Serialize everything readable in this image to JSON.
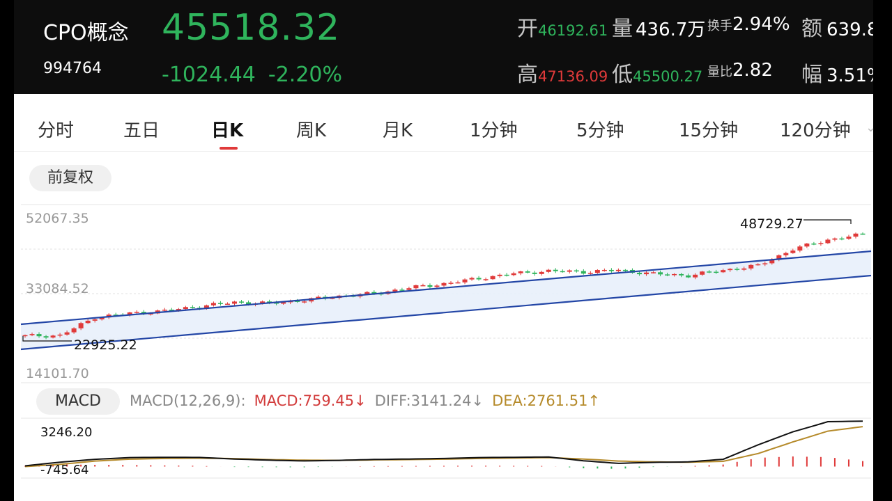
{
  "header": {
    "name": "CPO概念",
    "code": "994764",
    "price": "45518.32",
    "change": "-1024.44",
    "change_pct": "-2.20%",
    "open_label": "开",
    "open": "46192.61",
    "volume_label": "量",
    "volume": "436.7万",
    "turnover_label": "换手",
    "turnover": "2.94%",
    "amount_label": "额",
    "amount": "639.8",
    "high_label": "高",
    "high": "47136.09",
    "low_label": "低",
    "low": "45500.27",
    "vol_ratio_label": "量比",
    "vol_ratio": "2.82",
    "amplitude_label": "幅",
    "amplitude": "3.51%"
  },
  "tabs": [
    {
      "label": "分时"
    },
    {
      "label": "五日"
    },
    {
      "label": "日K",
      "active": true
    },
    {
      "label": "周K"
    },
    {
      "label": "月K"
    },
    {
      "label": "1分钟"
    },
    {
      "label": "5分钟"
    },
    {
      "label": "15分钟"
    },
    {
      "label": "120分钟"
    }
  ],
  "adjust_button": "前复权",
  "chart_labels": {
    "y_top": "52067.35",
    "y_mid": "33084.52",
    "y_bottom": "14101.70",
    "max_marker": "48729.27",
    "min_marker": "22925.22"
  },
  "macd": {
    "pill": "MACD",
    "params": "MACD(12,26,9):",
    "macd_value": "MACD:759.45↓",
    "diff_value": "DIFF:3141.24↓",
    "dea_value": "DEA:2761.51↑",
    "y_top": "3246.20",
    "y_bottom": "-745.64"
  },
  "colors": {
    "up": "#e03a3a",
    "down": "#2fb45c",
    "channel": "#2346a6",
    "dea": "#b58a2a",
    "diff": "#111111"
  },
  "chart_data": {
    "type": "candlestick",
    "ylim": [
      14101.7,
      52067.35
    ],
    "x": [
      0,
      5,
      10,
      15,
      20,
      25,
      30,
      35,
      40,
      45,
      50,
      55,
      60,
      65,
      70,
      75,
      80,
      85,
      90,
      95,
      100,
      105,
      110,
      115,
      120
    ],
    "close": [
      23300,
      23400,
      27800,
      28800,
      29400,
      30500,
      31500,
      31200,
      32000,
      33000,
      33600,
      35000,
      36000,
      37300,
      38500,
      39100,
      38900,
      39300,
      38400,
      38000,
      39300,
      40400,
      44400,
      46700,
      48000
    ],
    "high_point": {
      "x": 118,
      "value": 48729.27
    },
    "low_point": {
      "x": 0,
      "value": 22925.22
    },
    "macd_ylim": [
      -745.64,
      3246.2
    ],
    "diff": [
      50,
      300,
      500,
      620,
      640,
      630,
      520,
      440,
      390,
      430,
      490,
      520,
      560,
      620,
      640,
      660,
      400,
      220,
      290,
      320,
      500,
      1500,
      2400,
      3100,
      3141.24
    ],
    "dea": [
      0,
      150,
      380,
      510,
      560,
      580,
      550,
      480,
      440,
      430,
      460,
      480,
      510,
      560,
      590,
      620,
      520,
      380,
      320,
      300,
      360,
      900,
      1700,
      2450,
      2761.51
    ]
  }
}
